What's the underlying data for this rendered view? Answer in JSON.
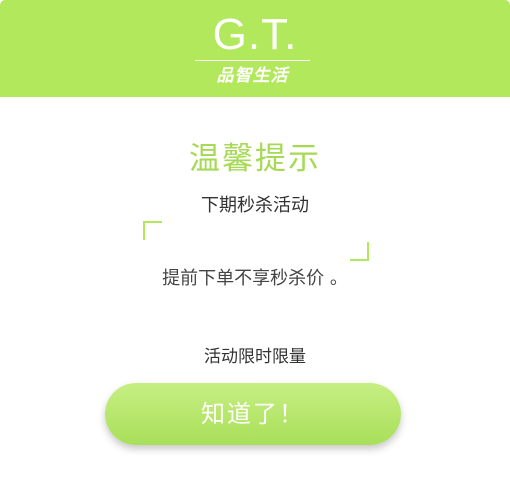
{
  "header": {
    "logo_text": "G.T.",
    "logo_subtext": "品智生活",
    "background_color": "#b2e85c"
  },
  "dialog": {
    "title": "温馨提示",
    "subtitle": "下期秒杀活动",
    "message": "提前下单不享秒杀价 。",
    "limit_note": "活动限时限量",
    "confirm_label": "知道了！",
    "accent_color": "#a6d955"
  }
}
